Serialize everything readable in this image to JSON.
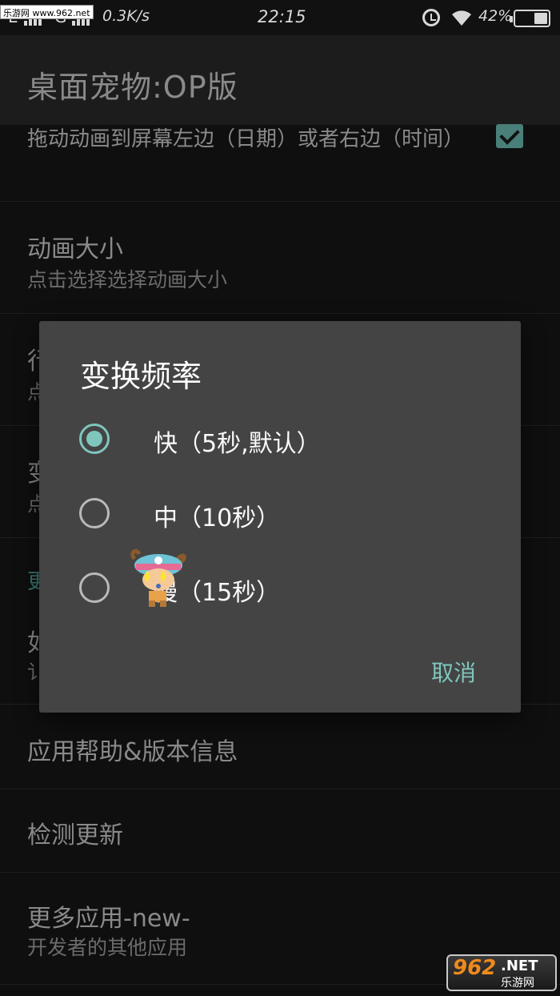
{
  "status_bar": {
    "network": "E",
    "network2": "G",
    "speed": "0.3K/s",
    "time": "22:15",
    "battery_percent": "42%",
    "battery_level": 0.42,
    "watermark": "乐游网 www.962.net"
  },
  "app_bar": {
    "title": "桌面宠物:OP版"
  },
  "list": {
    "row0_title": "拖动动画到屏幕左边（日期）或者右边（时间）",
    "row1_title": "动画大小",
    "row1_sub": "点击选择选择动画大小",
    "row2_title_partial": "行",
    "row2_sub_partial": "点",
    "row3_title_partial": "变",
    "row3_sub_partial": "点",
    "section_partial": "更",
    "row4_title_partial": "如",
    "row4_sub_partial": "讠",
    "row5_title": "应用帮助&版本信息",
    "row6_title": "检测更新",
    "row7_title": "更多应用-new-",
    "row7_sub": "开发者的其他应用"
  },
  "dialog": {
    "title": "变换频率",
    "options": [
      {
        "label": "快（5秒,默认）",
        "selected": true
      },
      {
        "label": "中（10秒）",
        "selected": false
      },
      {
        "label": "慢（15秒）",
        "selected": false
      }
    ],
    "cancel_label": "取消"
  },
  "watermark_br": {
    "number": "962",
    "net": ".NET",
    "cn": "乐游网"
  },
  "colors": {
    "accent": "#7fc6bd",
    "dialog_bg": "#444444",
    "checkbox": "#4a7f79"
  },
  "icons": {
    "checkbox": "checkmark-icon",
    "alarm": "alarm-icon",
    "wifi": "wifi-icon",
    "battery": "battery-icon",
    "signal": "signal-bars-icon",
    "pet": "chopper-pet-icon"
  }
}
